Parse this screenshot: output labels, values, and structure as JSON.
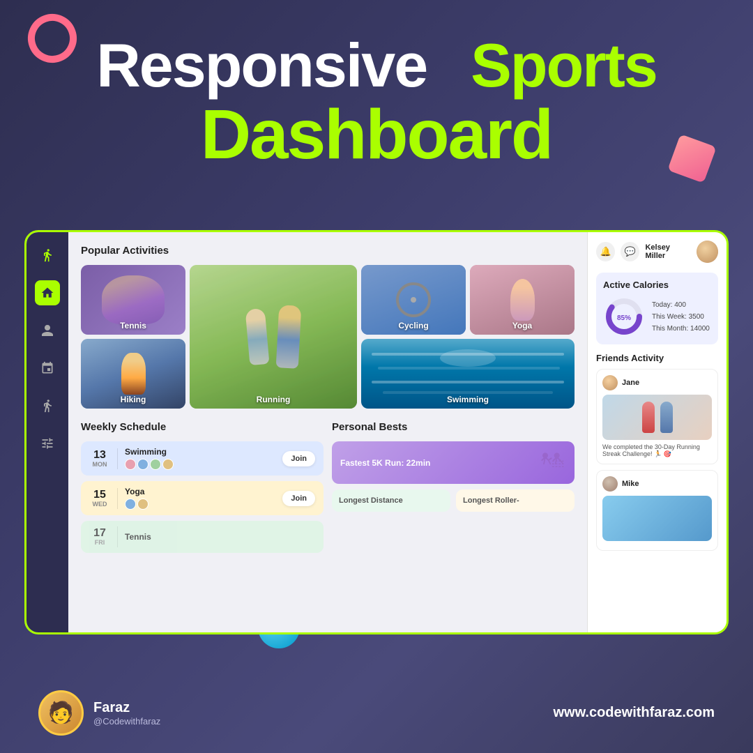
{
  "title": {
    "line1_white": "Responsive",
    "line1_green": "Sports",
    "line2": "Dashboard"
  },
  "sidebar": {
    "icons": [
      "run-icon",
      "home-icon",
      "person-icon",
      "calendar-icon",
      "activity-icon",
      "settings-icon"
    ]
  },
  "popular_activities": {
    "section_title": "Popular Activities",
    "items": [
      {
        "name": "Tennis",
        "id": "tennis"
      },
      {
        "name": "Running",
        "id": "running"
      },
      {
        "name": "Cycling",
        "id": "cycling"
      },
      {
        "name": "Yoga",
        "id": "yoga"
      },
      {
        "name": "Hiking",
        "id": "hiking"
      },
      {
        "name": "Swimming",
        "id": "swimming"
      }
    ]
  },
  "weekly_schedule": {
    "section_title": "Weekly Schedule",
    "items": [
      {
        "day_num": "13",
        "day_name": "MON",
        "sport": "Swimming",
        "bg": "blue-bg"
      },
      {
        "day_num": "15",
        "day_name": "WED",
        "sport": "Yoga",
        "bg": "yellow-bg"
      },
      {
        "day_num": "17",
        "day_name": "FRI",
        "sport": "Tennis",
        "bg": "green-bg"
      }
    ],
    "join_label": "Join"
  },
  "personal_bests": {
    "section_title": "Personal Bests",
    "items": [
      {
        "label": "Fastest 5K Run: 22min"
      },
      {
        "label": "Longest Distance"
      },
      {
        "label": "Longest Roller-"
      }
    ]
  },
  "right_panel": {
    "user_name": "Kelsey Miller",
    "active_calories": {
      "title": "Active Calories",
      "percent": "85%",
      "today": "Today: 400",
      "this_week": "This Week: 3500",
      "this_month": "This Month: 14000"
    },
    "friends": {
      "title": "Friends Activity",
      "items": [
        {
          "name": "Jane",
          "caption": "We completed the 30-Day Running Streak Challenge! 🏃 🎯"
        },
        {
          "name": "Mike",
          "caption": ""
        }
      ]
    }
  },
  "branding": {
    "name": "Faraz",
    "handle": "@Codewithfaraz",
    "url": "www.codewithfaraz.com"
  }
}
